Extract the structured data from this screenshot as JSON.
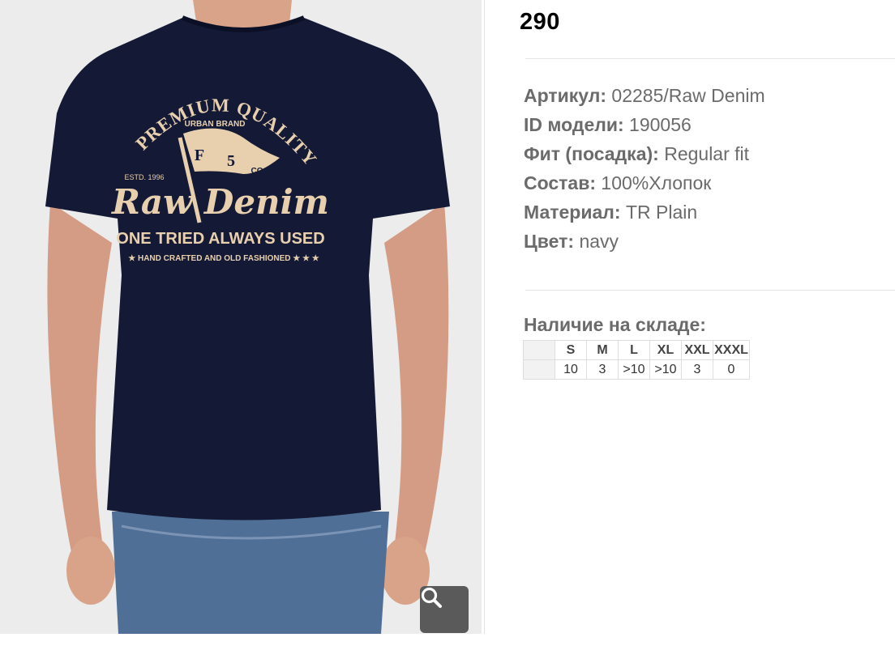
{
  "product": {
    "price": "290",
    "image_alt": "Футболка navy Raw Denim",
    "print": {
      "arc_text": "PREMIUM QUALITY",
      "brand_line": "URBAN BRAND",
      "estd": "ESTD. 1996",
      "flag_f": "F",
      "flag_5": "5",
      "flag_co": "CO",
      "script_title": "Raw Denim",
      "slogan": "ONE TRIED ALWAYS USED",
      "footer": "★ HAND CRAFTED AND OLD FASHIONED ★ ★ ★"
    }
  },
  "properties": [
    {
      "label": "Артикул:",
      "value": "02285/Raw Denim"
    },
    {
      "label": "ID модели:",
      "value": "190056"
    },
    {
      "label": "Фит (посадка):",
      "value": "Regular fit"
    },
    {
      "label": "Состав:",
      "value": "100%Хлопок"
    },
    {
      "label": "Материал:",
      "value": "TR Plain"
    },
    {
      "label": "Цвет:",
      "value": "navy"
    }
  ],
  "stock": {
    "title": "Наличие на складе:",
    "sizes": [
      "S",
      "M",
      "L",
      "XL",
      "XXL",
      "XXXL"
    ],
    "counts": [
      "10",
      "3",
      ">10",
      ">10",
      "3",
      "0"
    ]
  },
  "icons": {
    "zoom": "magnifier-icon"
  },
  "colors": {
    "shirt": "#141a36",
    "print": "#e8cfae",
    "jeans": "#4f6f97",
    "skin": "#d9a38a"
  }
}
